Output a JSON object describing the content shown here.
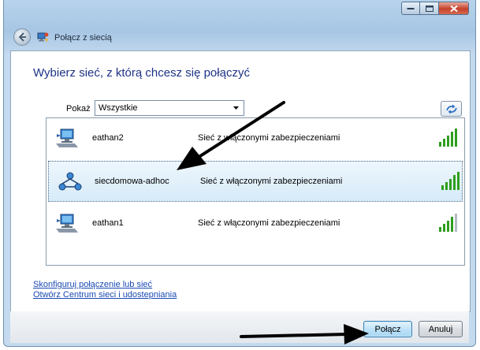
{
  "window": {
    "title": "Połącz z siecią"
  },
  "main": {
    "heading": "Wybierz sieć, z którą chcesz się połączyć",
    "filter_label": "Pokaż",
    "filter_value": "Wszystkie"
  },
  "networks": [
    {
      "name": "eathan2",
      "security": "Sieć z włączonymi zabezpieczeniami",
      "icon": "wireless-network-icon",
      "signal_bars": 5,
      "selected": false
    },
    {
      "name": "siecdomowa-adhoc",
      "security": "Sieć z włączonymi zabezpieczeniami",
      "icon": "adhoc-network-icon",
      "signal_bars": 5,
      "selected": true
    },
    {
      "name": "eathan1",
      "security": "Sieć z włączonymi zabezpieczeniami",
      "icon": "wireless-network-icon",
      "signal_bars": 4,
      "selected": false
    }
  ],
  "links": {
    "setup": "Skonfiguruj połączenie lub sieć",
    "network_center": "Otwórz Centrum sieci i udostepniania"
  },
  "buttons": {
    "connect": "Połącz",
    "cancel": "Anuluj"
  },
  "colors": {
    "heading": "#1e3287",
    "link": "#1a49b3",
    "signal": "#2f9e1e",
    "selection": "#d6ebf9"
  }
}
